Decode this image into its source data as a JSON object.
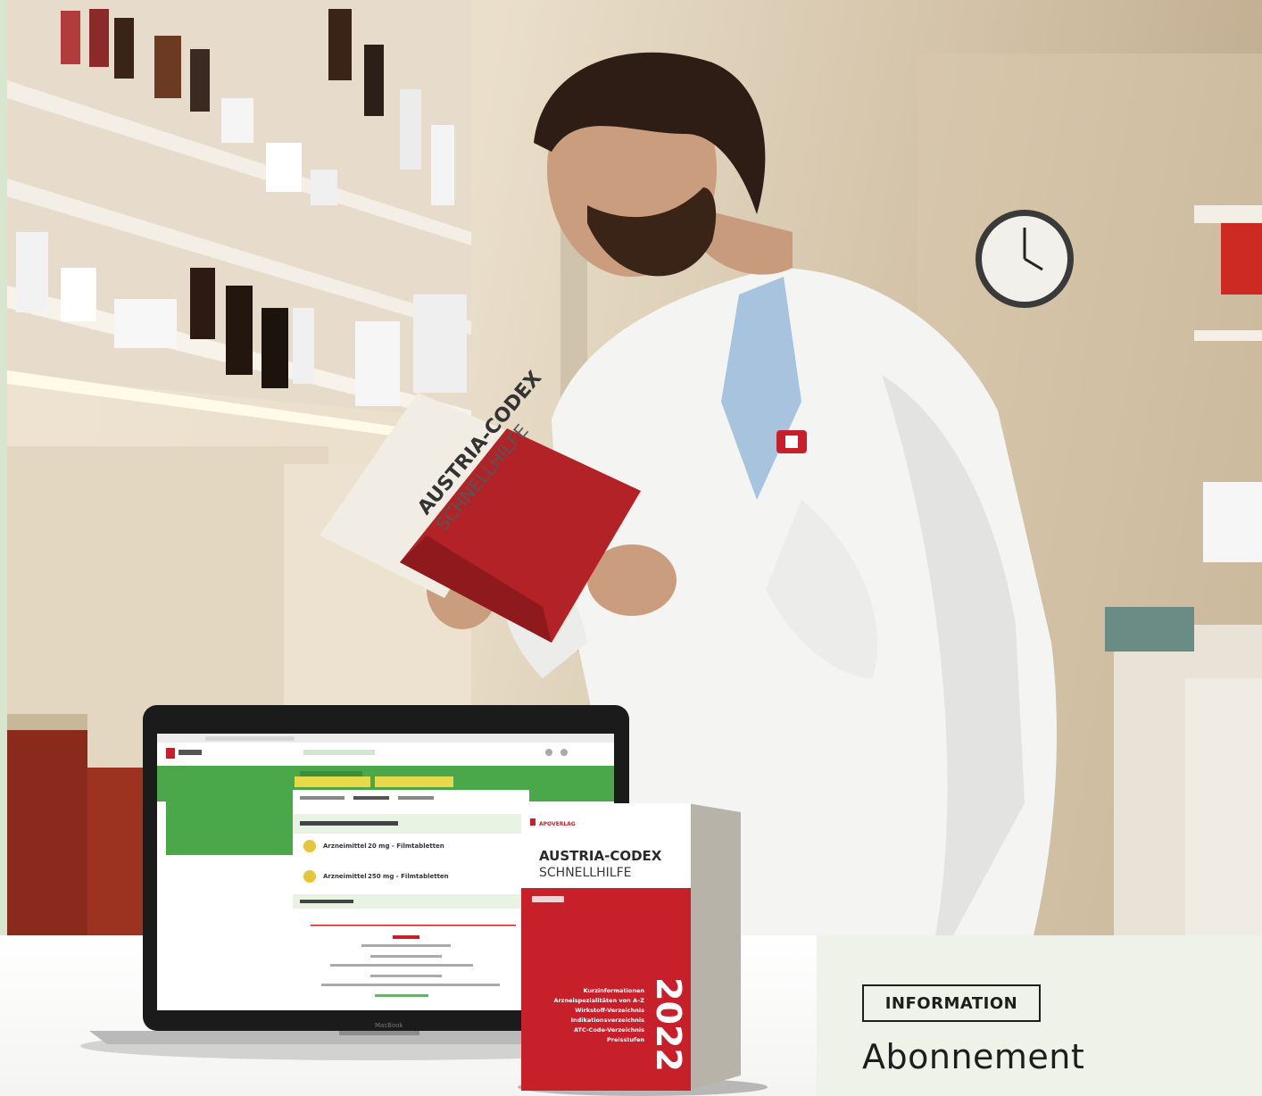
{
  "info": {
    "badge": "INFORMATION",
    "title": "Abonnement"
  },
  "book": {
    "brand": "APOVERLAG",
    "title_line1": "AUSTRIA-CODEX",
    "title_line2": "SCHNELLHILFE",
    "year": "2022",
    "features": [
      "Kurzinformationen",
      "Arzneispezialitäten von A–Z",
      "Wirkstoff-Verzeichnis",
      "Indikationsverzeichnis",
      "ATC-Code-Verzeichnis",
      "Preisstufen"
    ]
  },
  "handheld_book": {
    "title_line1": "AUSTRIA-CODEX",
    "title_line2": "SCHNELLHILFE"
  },
  "laptop": {
    "brand": "MacBook",
    "list": [
      {
        "name": "Arzneimittel",
        "dose": "20 mg - Filmtabletten"
      },
      {
        "name": "Arzneimittel",
        "dose": "250 mg - Filmtabletten"
      }
    ]
  },
  "colors": {
    "accent_green": "#4aa84a",
    "brand_red": "#c8202a",
    "panel_bg": "#eef2e8"
  }
}
